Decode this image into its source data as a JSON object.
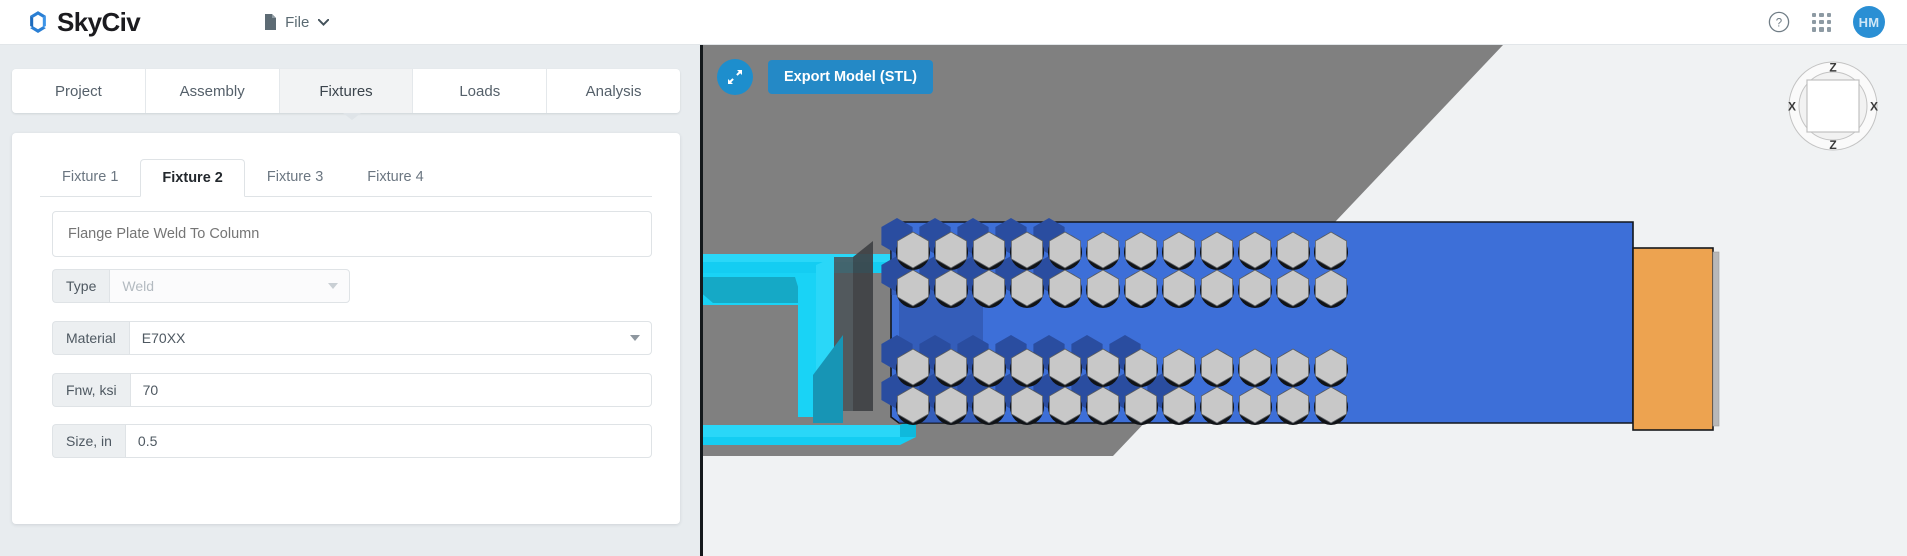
{
  "app": {
    "brand": "SkyCiv",
    "brand_color": "#2a7fd4"
  },
  "topbar": {
    "file_menu_label": "File",
    "file_icon": "document-icon",
    "caret_icon": "chevron-down-icon",
    "help_icon": "help-circle-icon",
    "apps_icon": "apps-grid-icon",
    "avatar_initials": "HM",
    "avatar_color": "#2a8fd4"
  },
  "main_tabs": [
    {
      "label": "Project",
      "active": false
    },
    {
      "label": "Assembly",
      "active": false
    },
    {
      "label": "Fixtures",
      "active": true
    },
    {
      "label": "Loads",
      "active": false
    },
    {
      "label": "Analysis",
      "active": false
    }
  ],
  "fixture_tabs": [
    {
      "label": "Fixture 1",
      "active": false
    },
    {
      "label": "Fixture 2",
      "active": true
    },
    {
      "label": "Fixture 3",
      "active": false
    },
    {
      "label": "Fixture 4",
      "active": false
    }
  ],
  "form": {
    "name_value": "Flange Plate Weld To Column",
    "name_placeholder": "Flange Plate Weld To Column",
    "fields": [
      {
        "label": "Type",
        "value": "Weld",
        "control": "select",
        "disabled": true
      },
      {
        "label": "Material",
        "value": "E70XX",
        "control": "select",
        "disabled": false
      },
      {
        "label": "Fnw, ksi",
        "value": "70",
        "control": "input",
        "disabled": false
      },
      {
        "label": "Size, in",
        "value": "0.5",
        "control": "input",
        "disabled": false
      }
    ]
  },
  "viewport": {
    "fullscreen_icon": "expand-arrows-icon",
    "export_button_label": "Export Model (STL)",
    "gizmo": {
      "icon": "view-orientation-gizmo",
      "axis_left": "X",
      "axis_right": "X",
      "axis_top": "Z",
      "axis_bottom": "Z"
    },
    "colors": {
      "background": "#f0f2f3",
      "shadow": "#808080",
      "column_beam": "#16d0f5",
      "plate": "#3d6fd8",
      "bolt": "#c8c8c8",
      "far_beam": "#eda350",
      "accent": "#2489c6"
    },
    "model": {
      "column_label": "I-beam column",
      "plate_label": "flange plate",
      "bolt_rows": 4,
      "bolt_columns": 12,
      "bolt_count": 48
    }
  }
}
